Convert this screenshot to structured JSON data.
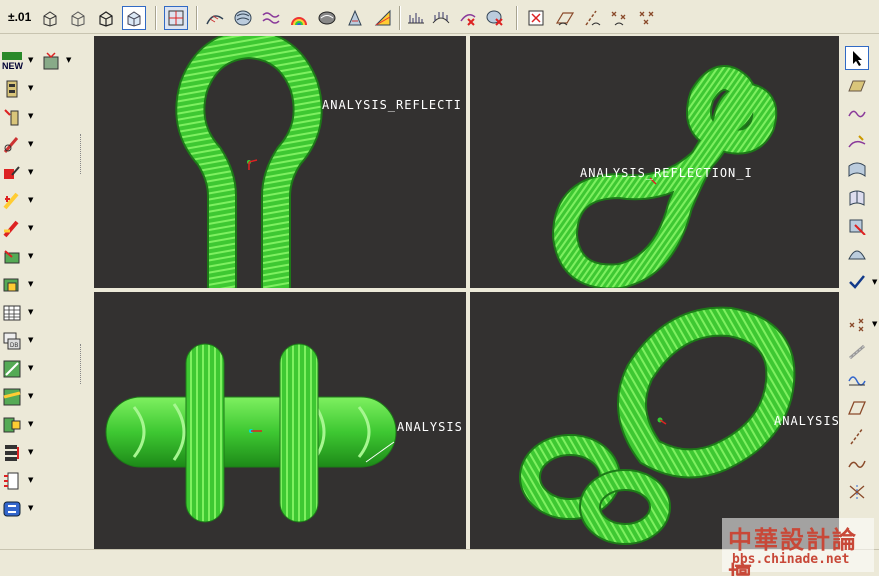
{
  "toolbar": {
    "precision_label": "±.01",
    "icons": [
      "wireframe-view-icon",
      "hidden-line-view-icon",
      "no-hidden-view-icon",
      "shaded-view-icon",
      "view-manager-icon",
      "curve-analysis-icon",
      "reflection-analysis-icon",
      "curvature-analysis-icon",
      "shade-analysis-icon",
      "draft-analysis-icon",
      "slope-analysis-icon",
      "section-analysis-icon",
      "offset-analysis-icon",
      "dihedral-analysis-icon",
      "deviation-analysis-icon",
      "delete-analysis-icon",
      "plane-display-icon",
      "axis-display-icon",
      "point-display-icon",
      "csys-display-icon"
    ]
  },
  "left_toolbar": {
    "new_label": "NEW",
    "icons": [
      "datum-tools-icon",
      "pin-icon",
      "axis-tool-icon",
      "sketch-tool-icon",
      "edit-icon",
      "measure-icon",
      "relation-icon",
      "feature-icon",
      "layer-icon",
      "table-icon",
      "database-icon",
      "dimension-icon",
      "split-icon",
      "merge-icon",
      "stack-icon",
      "list-icon",
      "group-icon"
    ]
  },
  "views": [
    {
      "name": "top-left-view",
      "annotation": "ANALYSIS_REFLECTI"
    },
    {
      "name": "top-right-view",
      "annotation": "ANALYSIS_REFLECTION_I"
    },
    {
      "name": "bottom-left-view",
      "annotation": "ANALYSIS"
    },
    {
      "name": "bottom-right-view",
      "annotation": "ANALYSIS"
    }
  ],
  "right_toolbar": {
    "icons": [
      "select-icon",
      "plane-icon",
      "curve-icon",
      "sketch-curve-icon",
      "surface-icon",
      "boundary-icon",
      "offset-surface-icon",
      "style-icon",
      "done-checkmark-icon",
      "point-icon",
      "chain-icon",
      "wave-icon",
      "datum-plane-icon",
      "dashed-line-icon",
      "spline-icon",
      "intersect-icon"
    ]
  },
  "watermark": {
    "title": "中華設計論壇",
    "url": "bbs.chinade.net"
  },
  "colors": {
    "viewport_bg": "#333130",
    "model_green": "#3ec832",
    "model_light": "#7ef060",
    "toolbar_bg": "#ece9d8"
  }
}
